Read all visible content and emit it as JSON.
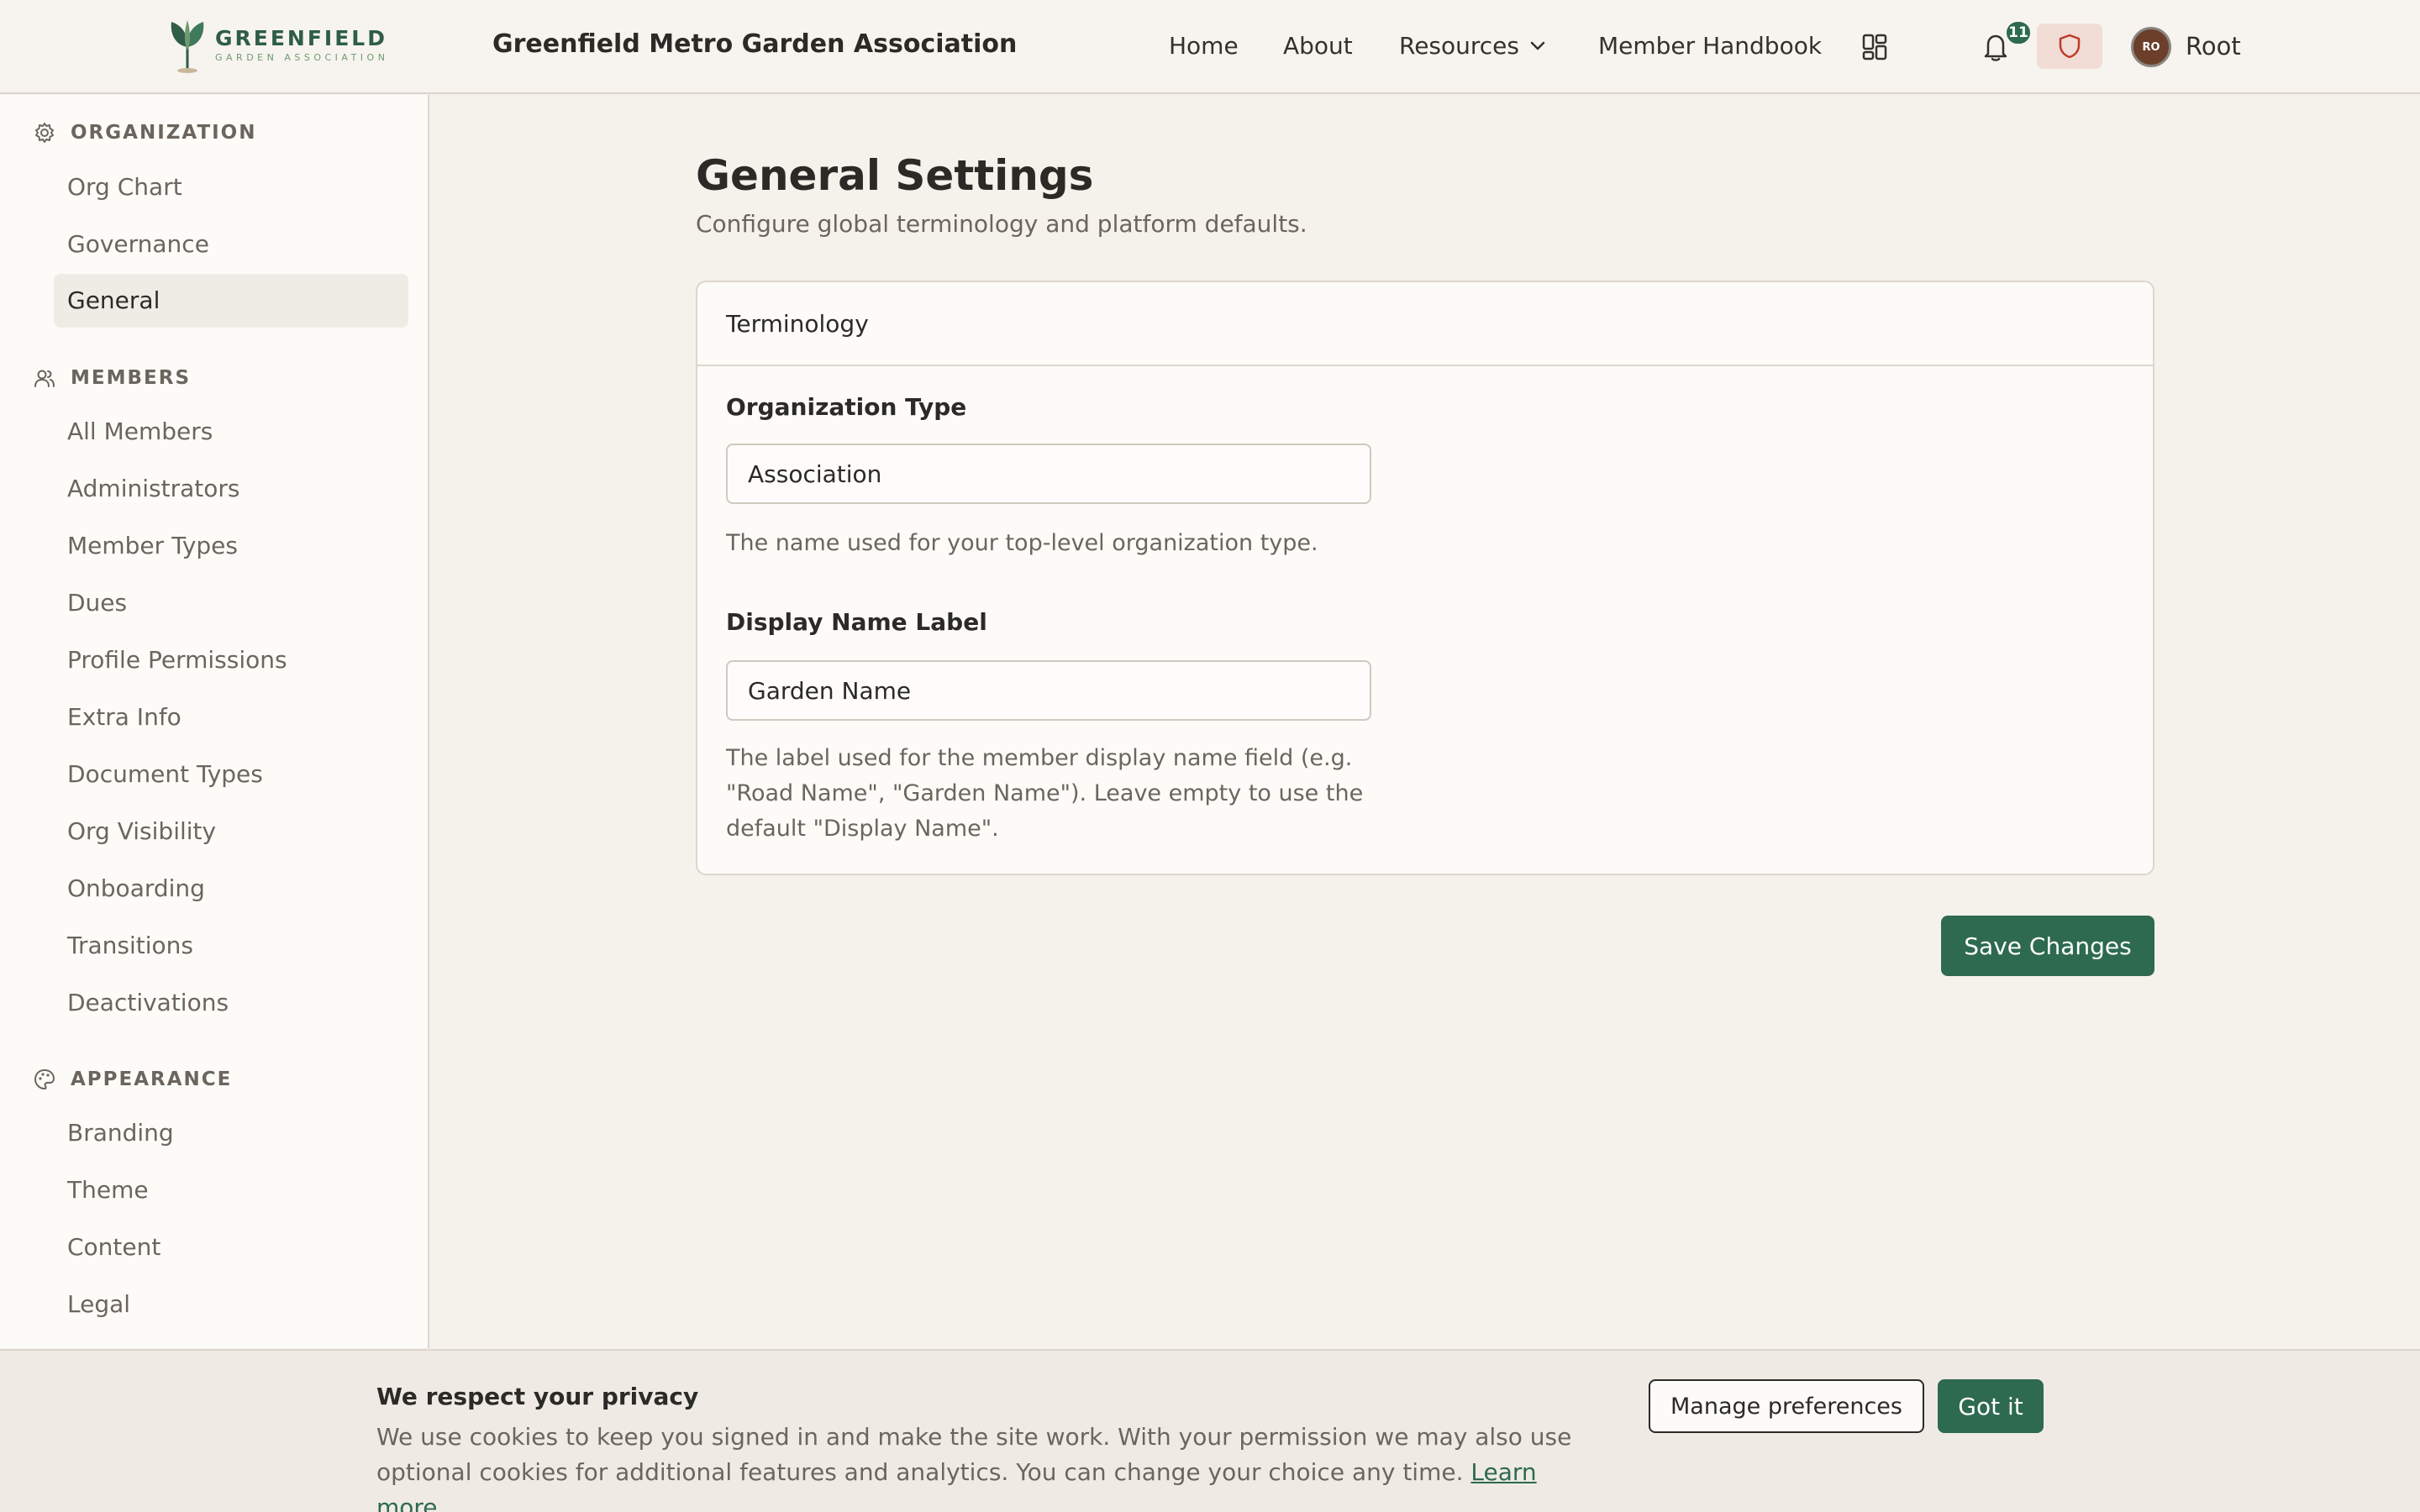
{
  "header": {
    "logo_name": "GREENFIELD",
    "logo_sub": "GARDEN ASSOCIATION",
    "org_title": "Greenfield Metro Garden Association",
    "nav": {
      "home": "Home",
      "about": "About",
      "resources": "Resources",
      "handbook": "Member Handbook"
    },
    "notification_count": "11",
    "avatar_initials": "RO",
    "user_name": "Root",
    "icons": [
      "apps-grid-icon",
      "bell-icon",
      "shield-icon",
      "chevron-down-icon"
    ]
  },
  "sidebar": {
    "sections": [
      {
        "label": "ORGANIZATION",
        "icon": "gear-icon",
        "items": [
          "Org Chart",
          "Governance",
          "General"
        ]
      },
      {
        "label": "MEMBERS",
        "icon": "users-icon",
        "items": [
          "All Members",
          "Administrators",
          "Member Types",
          "Dues",
          "Profile Permissions",
          "Extra Info",
          "Document Types",
          "Org Visibility",
          "Onboarding",
          "Transitions",
          "Deactivations"
        ]
      },
      {
        "label": "APPEARANCE",
        "icon": "palette-icon",
        "items": [
          "Branding",
          "Theme",
          "Content",
          "Legal"
        ]
      }
    ],
    "active_item": "General"
  },
  "main": {
    "title": "General Settings",
    "subtitle": "Configure global terminology and platform defaults.",
    "card_title": "Terminology",
    "org_type": {
      "label": "Organization Type",
      "value": "Association",
      "help": "The name used for your top-level organization type."
    },
    "display_name": {
      "label": "Display Name Label",
      "value": "Garden Name",
      "help": "The label used for the member display name field (e.g. \"Road Name\", \"Garden Name\"). Leave empty to use the default \"Display Name\"."
    },
    "save_label": "Save Changes"
  },
  "cookie": {
    "title": "We respect your privacy",
    "text": "We use cookies to keep you signed in and make the site work. With your permission we may also use optional cookies for additional features and analytics. You can change your choice any time.",
    "link": "Learn more",
    "manage_label": "Manage preferences",
    "accept_label": "Got it"
  },
  "colors": {
    "accent": "#2d6a4f",
    "background": "#f5f1eb",
    "sidebar": "#fcfbf8",
    "shield_bg": "#f1dcd6"
  }
}
